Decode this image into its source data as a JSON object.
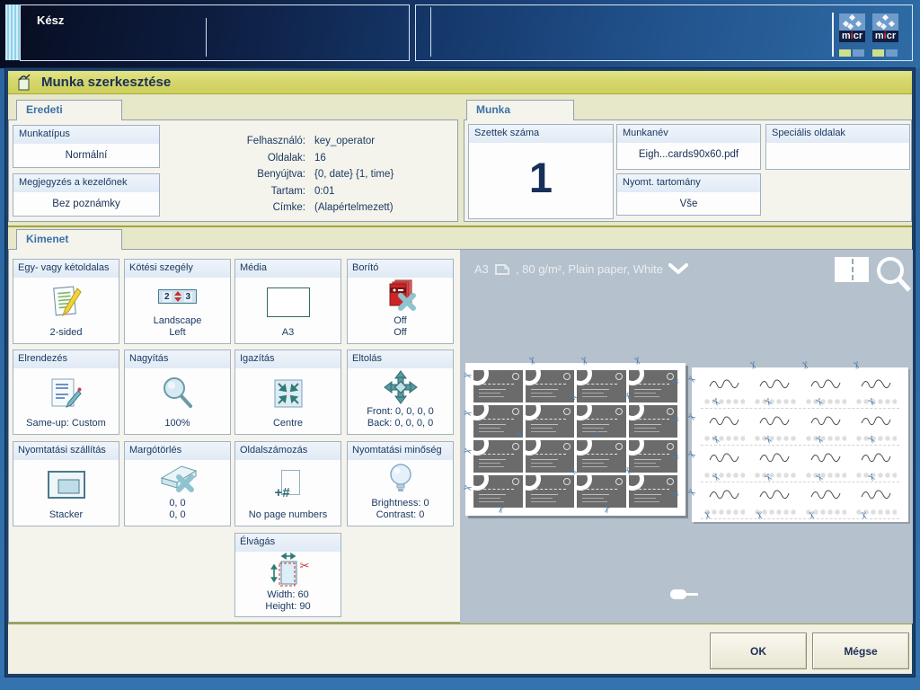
{
  "topbar": {
    "status": "Kész",
    "micr_parts": [
      "m",
      "i",
      "cr"
    ]
  },
  "icons": {
    "scissors": "✂"
  },
  "colors": {
    "title_yellow": "#d5d76d",
    "dialog_bg": "#e7e7c9",
    "section_bg": "#f4f3ec",
    "preview_bg": "#b5c1cc",
    "accent_navy": "#1b3a63",
    "scissors_blue": "#4d79a8"
  },
  "dialog": {
    "title": "Munka szerkesztése",
    "eredeti": {
      "tab": "Eredeti",
      "buttons": [
        {
          "header": "Munkatípus",
          "value": "Normální"
        },
        {
          "header": "Megjegyzés a kezelőnek",
          "value": "Bez poznámky"
        }
      ],
      "info": [
        {
          "label": "Felhasználó:",
          "value": "key_operator"
        },
        {
          "label": "Oldalak:",
          "value": "16"
        },
        {
          "label": "Benyújtva:",
          "value": "{0, date} {1, time}"
        },
        {
          "label": "Tartam:",
          "value": "0:01"
        },
        {
          "label": "Címke:",
          "value": "(Alapértelmezett)"
        }
      ]
    },
    "munka": {
      "tab": "Munka",
      "szettek": {
        "header": "Szettek száma",
        "value": "1"
      },
      "munkanev": {
        "header": "Munkanév",
        "value": "Eigh...cards90x60.pdf"
      },
      "nyomt": {
        "header": "Nyomt. tartomány",
        "value": "Vše"
      },
      "specialis": {
        "header": "Speciális oldalak",
        "value": ""
      }
    },
    "kimenet": {
      "tab": "Kimenet",
      "binding_icon": {
        "left": "2",
        "right": "3"
      },
      "pagenum_icon": "+#",
      "buttons": [
        {
          "header": "Egy- vagy kétoldalas",
          "value": "2-sided"
        },
        {
          "header": "Kötési szegély",
          "value": "Landscape\nLeft"
        },
        {
          "header": "Média",
          "value": "A3"
        },
        {
          "header": "Borító",
          "value": "Off\nOff"
        },
        {
          "header": "Elrendezés",
          "value": "Same-up: Custom"
        },
        {
          "header": "Nagyítás",
          "value": "100%"
        },
        {
          "header": "Igazítás",
          "value": "Centre"
        },
        {
          "header": "Eltolás",
          "value": "Front: 0, 0, 0, 0\nBack: 0, 0, 0, 0"
        },
        {
          "header": "Nyomtatási szállítás",
          "value": "Stacker"
        },
        {
          "header": "Margótörlés",
          "value": "0, 0\n0, 0"
        },
        {
          "header": "Oldalszámozás",
          "value": "No page numbers"
        },
        {
          "header": "Nyomtatási minőség",
          "value": "Brightness: 0\nContrast: 0"
        },
        {
          "header": "Élvágás",
          "value": "Width: 60\nHeight: 90"
        }
      ]
    },
    "preview": {
      "media_prefix": "A3",
      "media_suffix": ", 80 g/m², Plain paper, White",
      "grid": {
        "rows": 4,
        "cols": 4
      }
    },
    "footer": {
      "ok": "OK",
      "cancel": "Mégse"
    }
  }
}
